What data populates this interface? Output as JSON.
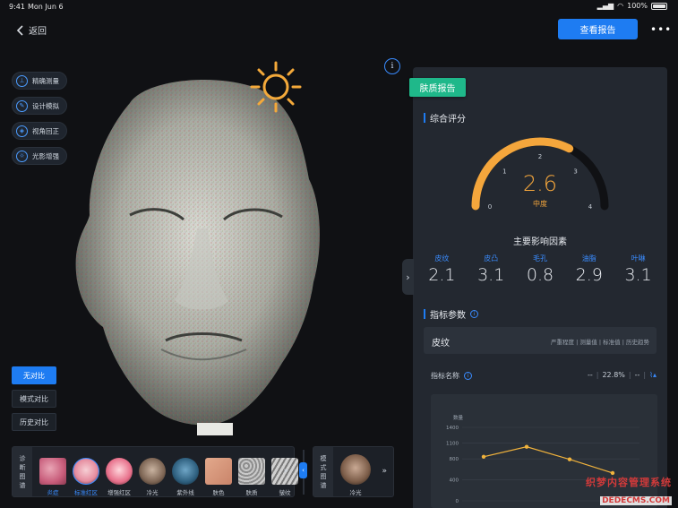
{
  "status_bar": {
    "time": "9:41",
    "date": "Mon Jun 6",
    "battery": "100%"
  },
  "header": {
    "back_label": "返回",
    "report_button": "查看报告",
    "more": "•••"
  },
  "tools": [
    {
      "label": "精确测量",
      "icon": "ruler-icon",
      "glyph": "⊥"
    },
    {
      "label": "设计模拟",
      "icon": "pen-icon",
      "glyph": "✎"
    },
    {
      "label": "视角回正",
      "icon": "cube-icon",
      "glyph": "◈"
    },
    {
      "label": "光影增强",
      "icon": "sun-icon",
      "glyph": "☼"
    }
  ],
  "compare_buttons": [
    "无对比",
    "模式对比",
    "历史对比"
  ],
  "diagnosis_strip": {
    "label": [
      "诊",
      "断",
      "图",
      "谱"
    ],
    "thumbs": [
      "炎症",
      "标准红区",
      "增强红区",
      "冷光",
      "紫外线",
      "肤色",
      "肤质",
      "皱纹"
    ]
  },
  "model_strip": {
    "label": [
      "模",
      "式",
      "图",
      "谱"
    ],
    "thumb": "冷光"
  },
  "panel": {
    "tag": "肤质报告",
    "overall_title": "综合评分",
    "gauge": {
      "value": "2.6",
      "level": "中度",
      "ticks": [
        "0",
        "1",
        "2",
        "3",
        "4"
      ],
      "score": 2.6,
      "max": 4
    },
    "factors_title": "主要影响因素",
    "factors": [
      {
        "name": "皮纹",
        "value": "2.1"
      },
      {
        "name": "皮凸",
        "value": "3.1"
      },
      {
        "name": "毛孔",
        "value": "0.8"
      },
      {
        "name": "油脂",
        "value": "2.9"
      },
      {
        "name": "叶啉",
        "value": "3.1"
      }
    ],
    "params_title": "指标参数",
    "tab": {
      "name": "皮纹",
      "options": "严重程度 | 测量值 | 标准值 | 历史趋势"
    },
    "indicator": {
      "name": "指标名称",
      "v1": "--",
      "v2": "22.8%",
      "v3": "--"
    }
  },
  "chart_data": {
    "type": "line",
    "ylabel": "数量",
    "yticks": [
      "1400",
      "1100",
      "800",
      "400",
      "0"
    ],
    "ylim": [
      0,
      1400
    ],
    "series": [
      {
        "values": [
          840,
          1030,
          790,
          530
        ]
      }
    ],
    "color": "#f0b23c"
  },
  "watermark": {
    "line1": "织梦内容管理系统",
    "line2": "DEDECMS.COM"
  },
  "colors": {
    "accent": "#1e7cf2",
    "tag": "#1fb88a",
    "gauge": "#f4a63c",
    "panel": "#232830"
  }
}
